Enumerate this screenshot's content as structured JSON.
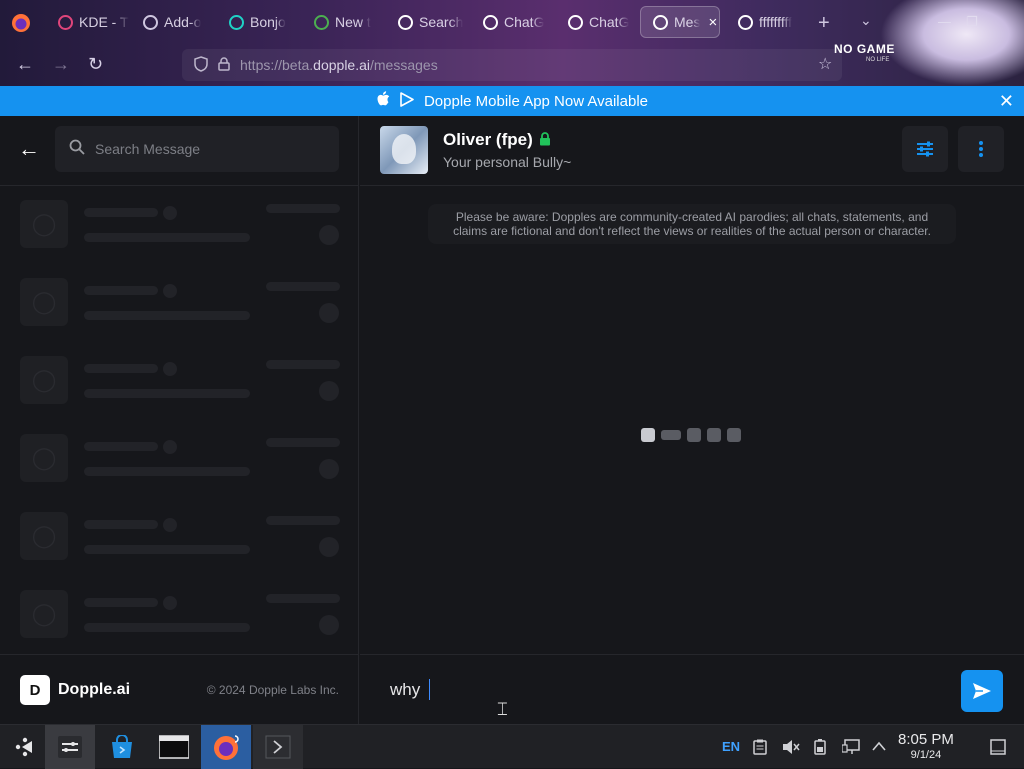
{
  "browser": {
    "tabs": [
      {
        "label": "KDE - T",
        "icon": "kde-icon",
        "color": "#e0457b"
      },
      {
        "label": "Add-o",
        "icon": "puzzle-icon",
        "color": "#cfc7e0"
      },
      {
        "label": "Bonjo",
        "icon": "bonjour-icon",
        "color": "#1fd3c6"
      },
      {
        "label": "New t",
        "icon": "newtab-icon",
        "color": "#4caf50"
      },
      {
        "label": "Search",
        "icon": "google-icon",
        "color": "#ffffff"
      },
      {
        "label": "ChatG",
        "icon": "chatgpt-icon",
        "color": "#ffffff"
      },
      {
        "label": "ChatG",
        "icon": "chatgpt-icon",
        "color": "#ffffff"
      },
      {
        "label": "Mes",
        "icon": "dopple-icon",
        "color": "#ffffff",
        "active": true
      },
      {
        "label": "fffffffff",
        "icon": "google-icon",
        "color": "#ffffff"
      }
    ],
    "url_prefix": "https://beta.",
    "url_domain": "dopple.ai",
    "url_path": "/messages",
    "wallpaper_title": "NO GAME",
    "wallpaper_subtitle": "NO LIFE"
  },
  "banner": {
    "text": "Dopple Mobile App Now Available"
  },
  "sidebar": {
    "search_placeholder": "Search Message",
    "skeleton_rows": 6,
    "footer_brand": "Dopple.ai",
    "footer_copyright": "© 2024 Dopple Labs Inc."
  },
  "chat": {
    "name": "Oliver (fpe)",
    "subtitle": "Your personal Bully~",
    "disclaimer": "Please be aware: Dopples are community-created AI parodies; all chats, statements, and claims are fictional and don't reflect the views or realities of the actual person or character.",
    "draft": "why"
  },
  "taskbar": {
    "lang": "EN",
    "time": "8:05 PM",
    "date": "9/1/24"
  },
  "colors": {
    "accent": "#1592f0",
    "lock": "#21c35b",
    "bg": "#16171b"
  }
}
